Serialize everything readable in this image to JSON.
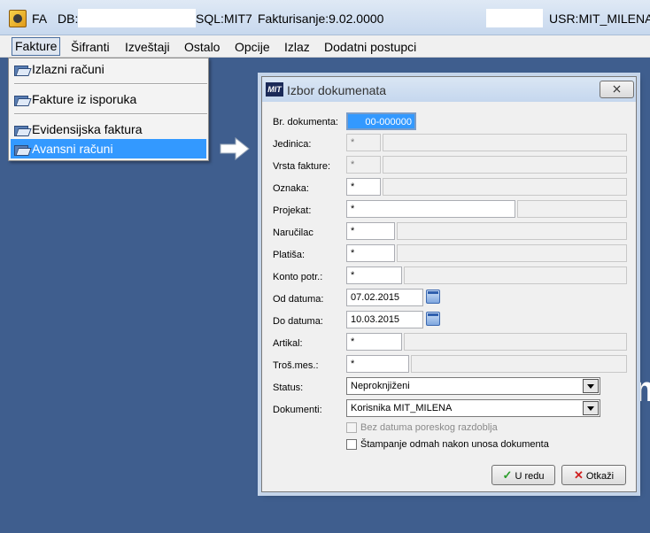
{
  "titlebar": {
    "app": "FA",
    "db_label": "DB:",
    "sql": "SQL:MIT7",
    "program": "Fakturisanje:9.02.0000",
    "user": "USR:MIT_MILENA"
  },
  "menubar": {
    "items": [
      "Fakture",
      "Šifranti",
      "Izveštaji",
      "Ostalo",
      "Opcije",
      "Izlaz",
      "Dodatni postupci"
    ]
  },
  "dropdown": {
    "items": [
      "Izlazni računi",
      "Fakture iz isporuka",
      "Evidensijska faktura",
      "Avansni računi"
    ],
    "highlighted": "Avansni računi"
  },
  "background_text": "m",
  "dialog": {
    "logo": "MIT",
    "title": "Izbor dokumenata",
    "close": "⨯",
    "fields": {
      "br_dokumenta": {
        "label": "Br. dokumenta:",
        "value": "00-000000"
      },
      "jedinica": {
        "label": "Jedinica:",
        "value": "*"
      },
      "vrsta_fakture": {
        "label": "Vrsta fakture:",
        "value": "*"
      },
      "oznaka": {
        "label": "Oznaka:",
        "value": "*"
      },
      "projekat": {
        "label": "Projekat:",
        "value": "*"
      },
      "narucilac": {
        "label": "Naručilac",
        "value": "*"
      },
      "platisa": {
        "label": "Platiša:",
        "value": "*"
      },
      "konto": {
        "label": "Konto potr.:",
        "value": "*"
      },
      "od_datuma": {
        "label": "Od datuma:",
        "value": "07.02.2015"
      },
      "do_datuma": {
        "label": "Do datuma:",
        "value": "10.03.2015"
      },
      "artikal": {
        "label": "Artikal:",
        "value": "*"
      },
      "tros_mes": {
        "label": "Troš.mes.:",
        "value": "*"
      },
      "status": {
        "label": "Status:",
        "value": "Neproknjiženi"
      },
      "dokumenti": {
        "label": "Dokumenti:",
        "value": "Korisnika MIT_MILENA"
      }
    },
    "checkboxes": {
      "bez_datuma": {
        "label": "Bez datuma poreskog razdoblja",
        "enabled": false,
        "checked": false
      },
      "stampanje": {
        "label": "Štampanje odmah nakon unosa dokumenta",
        "enabled": true,
        "checked": false
      }
    },
    "buttons": {
      "ok": "U redu",
      "cancel": "Otkaži"
    },
    "colors": {
      "accent": "#3399ff",
      "ok_icon": "#2a9d2a",
      "cancel_icon": "#d02020"
    }
  }
}
